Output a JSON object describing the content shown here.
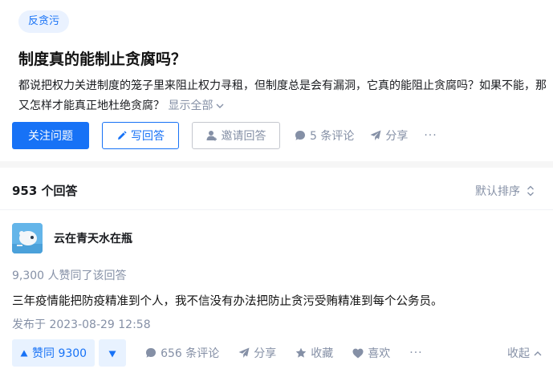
{
  "question": {
    "topic": "反贪污",
    "title": "制度真的能制止贪腐吗？",
    "description": "都说把权力关进制度的笼子里来阻止权力寻租，但制度总是会有漏洞，它真的能阻止贪腐吗？如果不能，那又怎样才能真正地杜绝贪腐？",
    "show_all": "显示全部",
    "actions": {
      "follow": "关注问题",
      "write": "写回答",
      "invite": "邀请回答",
      "comments": "5 条评论",
      "share": "分享",
      "more": "···"
    }
  },
  "answers": {
    "count_label": "953 个回答",
    "sort_label": "默认排序"
  },
  "answer": {
    "author": "云在青天水在瓶",
    "voters": "9,300 人赞同了该回答",
    "content": "三年疫情能把防疫精准到个人，我不信没有办法把防止贪污受贿精准到每个公务员。",
    "published": "发布于 2023-08-29 12:58",
    "actions": {
      "upvote": "赞同 9300",
      "comments": "656 条评论",
      "share": "分享",
      "favorite": "收藏",
      "like": "喜欢",
      "more": "···",
      "collapse": "收起"
    }
  },
  "colors": {
    "brand_blue": "#1772f6",
    "secondary_text": "#8590a6",
    "tag_bg": "#eaf2ff"
  },
  "icons": {
    "pencil": "pencil-icon",
    "invite": "invite-user-icon",
    "comment": "comment-bubble-icon",
    "share": "paper-plane-icon",
    "star": "star-icon",
    "heart": "heart-icon",
    "upvote": "triangle-up-icon",
    "downvote": "triangle-down-icon"
  }
}
